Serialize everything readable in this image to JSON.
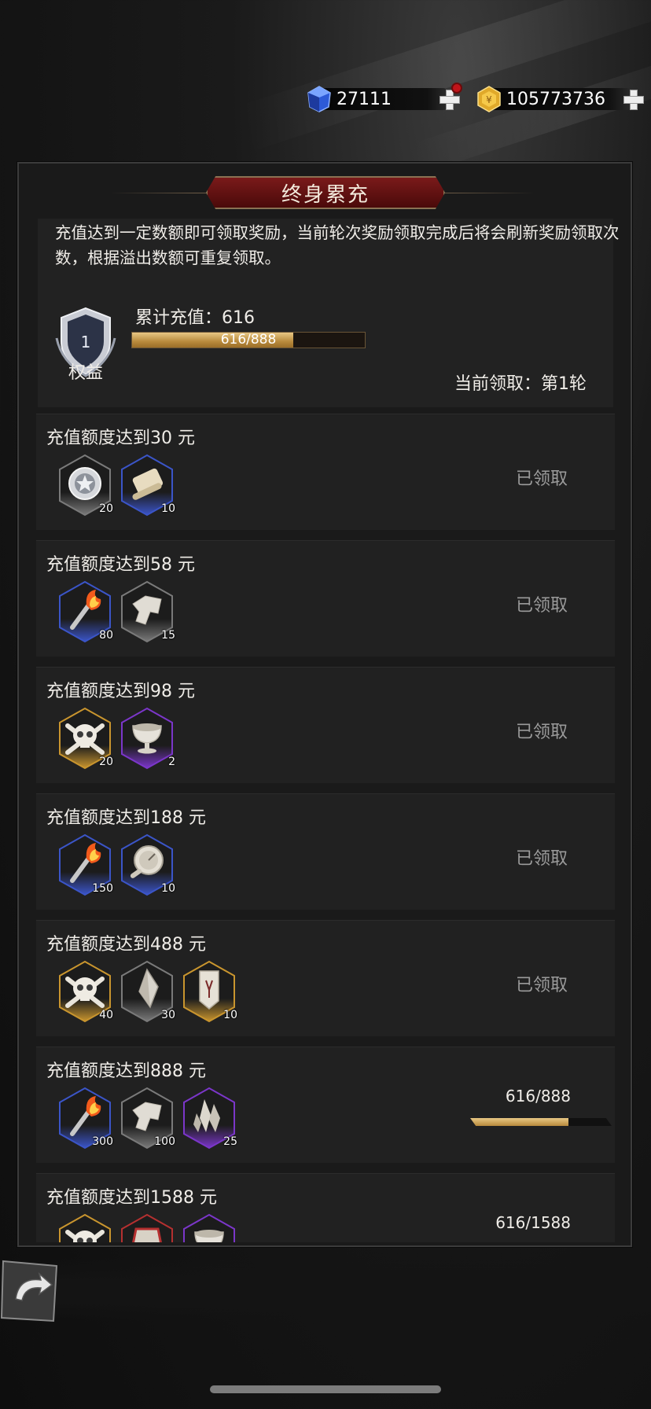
{
  "currency": {
    "gem_value": "27111",
    "gold_value": "105773736",
    "gem_icon": "blue-gem-icon",
    "gold_icon": "gold-coin-icon"
  },
  "panel": {
    "title": "终身累充",
    "description": "充值达到一定数额即可领取奖励，当前轮次奖励领取完成后将会刷新奖励领取次数，根据溢出数额可重复领取。",
    "badge_level": "1",
    "badge_label": "权益",
    "cumulative_label": "累计充值：616",
    "progress_text": "616/888",
    "progress_fraction": 0.694,
    "round_label": "当前领取：第1轮"
  },
  "tiers": [
    {
      "title": "充值额度达到30 元",
      "status": "已领取",
      "items": [
        {
          "icon": "silver-coin-icon",
          "rarity": "gray",
          "qty": "20"
        },
        {
          "icon": "scroll-icon",
          "rarity": "blue",
          "qty": "10"
        }
      ]
    },
    {
      "title": "充值额度达到58 元",
      "status": "已领取",
      "items": [
        {
          "icon": "torch-icon",
          "rarity": "blue",
          "qty": "80"
        },
        {
          "icon": "fragment-icon",
          "rarity": "gray",
          "qty": "15"
        }
      ]
    },
    {
      "title": "充值额度达到98 元",
      "status": "已领取",
      "items": [
        {
          "icon": "skull-icon",
          "rarity": "gold",
          "qty": "20"
        },
        {
          "icon": "chalice-icon",
          "rarity": "purple",
          "qty": "2"
        }
      ]
    },
    {
      "title": "充值额度达到188 元",
      "status": "已领取",
      "items": [
        {
          "icon": "torch-icon",
          "rarity": "blue",
          "qty": "150"
        },
        {
          "icon": "compass-icon",
          "rarity": "blue",
          "qty": "10"
        }
      ]
    },
    {
      "title": "充值额度达到488 元",
      "status": "已领取",
      "items": [
        {
          "icon": "skull-icon",
          "rarity": "gold",
          "qty": "40"
        },
        {
          "icon": "crystal-icon",
          "rarity": "gray",
          "qty": "30"
        },
        {
          "icon": "rune-tablet-icon",
          "rarity": "gold",
          "qty": "10"
        }
      ]
    },
    {
      "title": "充值额度达到888 元",
      "status": "",
      "progress_text": "616/888",
      "progress_fraction": 0.694,
      "items": [
        {
          "icon": "torch-icon",
          "rarity": "blue",
          "qty": "300"
        },
        {
          "icon": "fragment-icon",
          "rarity": "gray",
          "qty": "100"
        },
        {
          "icon": "crystal-cluster-icon",
          "rarity": "purple",
          "qty": "25"
        }
      ]
    },
    {
      "title": "充值额度达到1588 元",
      "status": "",
      "progress_text": "616/1588",
      "progress_fraction": 0.388,
      "items": [
        {
          "icon": "skull-icon",
          "rarity": "gold",
          "qty": ""
        },
        {
          "icon": "red-relic-icon",
          "rarity": "red",
          "qty": ""
        },
        {
          "icon": "chalice-icon",
          "rarity": "purple",
          "qty": ""
        }
      ]
    }
  ],
  "colors": {
    "gray": "#7a7a7a",
    "blue": "#3b55c8",
    "purple": "#7b36c9",
    "gold": "#c9952e",
    "red": "#b53030",
    "accent_gold": "#c9a058"
  },
  "nav": {
    "back_icon": "back-arrow-icon"
  }
}
